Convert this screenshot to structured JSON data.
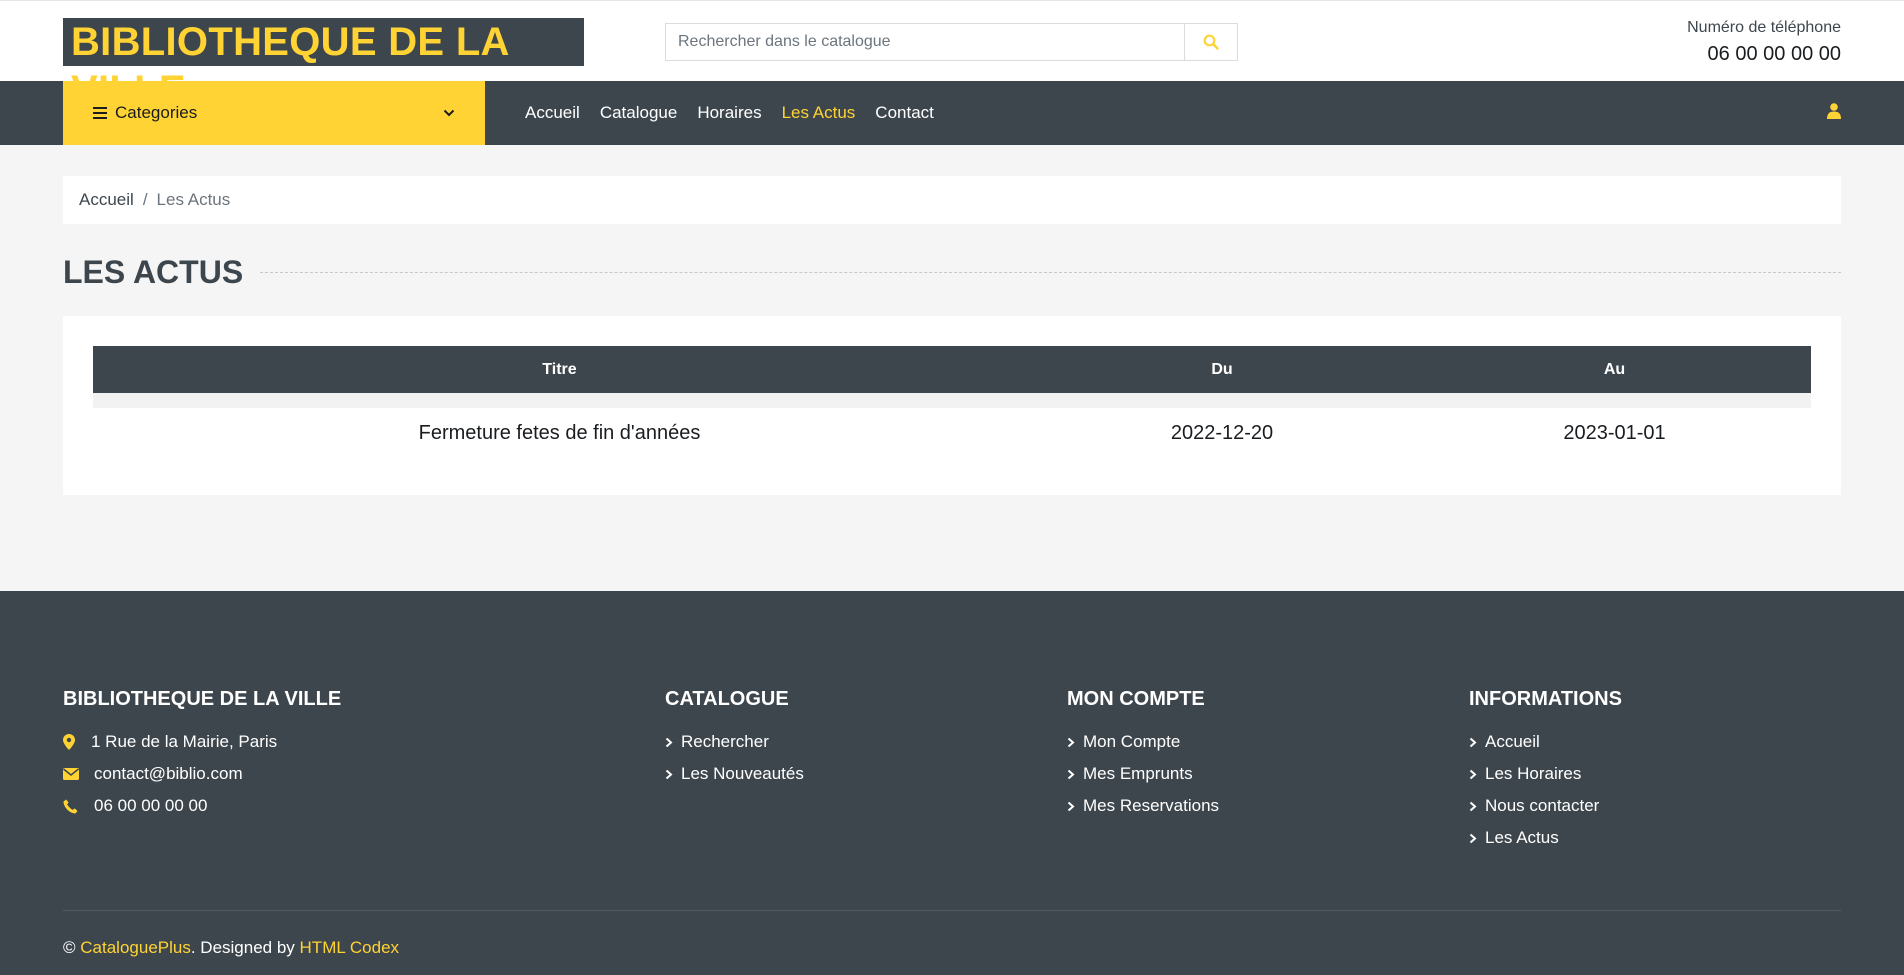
{
  "header": {
    "logo": "BIBLIOTHEQUE DE LA VILLE",
    "search_placeholder": "Rechercher dans le catalogue",
    "phone_label": "Numéro de téléphone",
    "phone_number": "06 00 00 00 00"
  },
  "nav": {
    "categories": "Categories",
    "links": [
      "Accueil",
      "Catalogue",
      "Horaires",
      "Les Actus",
      "Contact"
    ],
    "active": "Les Actus"
  },
  "breadcrumb": {
    "home": "Accueil",
    "separator": "/",
    "current": "Les Actus"
  },
  "page_title": "LES ACTUS",
  "table": {
    "headers": [
      "Titre",
      "Du",
      "Au"
    ],
    "rows": [
      [
        "Fermeture fetes de fin d'années",
        "2022-12-20",
        "2023-01-01"
      ]
    ]
  },
  "footer": {
    "about": {
      "title": "BIBLIOTHEQUE DE LA VILLE",
      "address": "1 Rue de la Mairie, Paris",
      "email": "contact@biblio.com",
      "phone": "06 00 00 00 00"
    },
    "catalogue": {
      "title": "CATALOGUE",
      "links": [
        "Rechercher",
        "Les Nouveautés"
      ]
    },
    "account": {
      "title": "MON COMPTE",
      "links": [
        "Mon Compte",
        "Mes Emprunts",
        "Mes Reservations"
      ]
    },
    "info": {
      "title": "INFORMATIONS",
      "links": [
        "Accueil",
        "Les Horaires",
        "Nous contacter",
        "Les Actus"
      ]
    },
    "copyright": {
      "symbol": "©",
      "brand": "CataloguePlus",
      "middle": ". Designed by",
      "designer": "HTML Codex"
    }
  },
  "colors": {
    "accent": "#ffd333",
    "dark": "#3d464d",
    "background": "#f5f5f5"
  },
  "icons": [
    "search-icon",
    "bars-icon",
    "chevron-down-icon",
    "user-icon",
    "map-marker-icon",
    "envelope-icon",
    "phone-icon",
    "chevron-right-icon"
  ]
}
